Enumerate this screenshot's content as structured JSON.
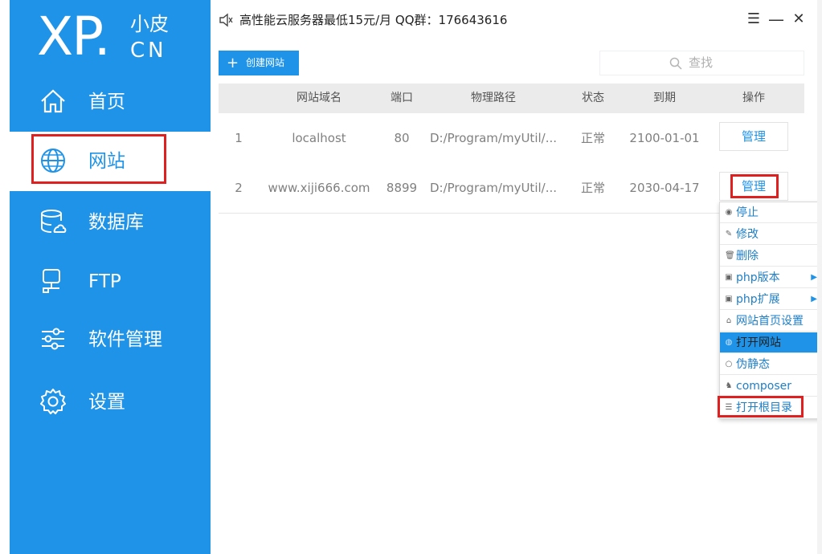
{
  "logo": {
    "main": "XP.",
    "top": "小皮",
    "bottom": "CN"
  },
  "sidebar": {
    "items": [
      {
        "label": "首页",
        "icon": "home-icon"
      },
      {
        "label": "网站",
        "icon": "globe-icon"
      },
      {
        "label": "数据库",
        "icon": "database-icon"
      },
      {
        "label": "FTP",
        "icon": "ftp-server-icon"
      },
      {
        "label": "软件管理",
        "icon": "sliders-icon"
      },
      {
        "label": "设置",
        "icon": "gear-icon"
      }
    ],
    "active_index": 1
  },
  "titlebar": {
    "announcement": "高性能云服务器最低15元/月  QQ群：176643616",
    "menu_glyph": "☰",
    "minimize_glyph": "—",
    "close_glyph": "✕"
  },
  "toolbar": {
    "create_label": "创建网站",
    "create_glyph": "+",
    "search_placeholder": "查找"
  },
  "table": {
    "columns": [
      "网站域名",
      "端口",
      "物理路径",
      "状态",
      "到期",
      "操作"
    ],
    "rows": [
      {
        "index": "1",
        "domain": "localhost",
        "port": "80",
        "path": "D:/Program/myUtil/...",
        "status": "正常",
        "expiry": "2100-01-01",
        "action": "管理"
      },
      {
        "index": "2",
        "domain": "www.xiji666.com",
        "port": "8899",
        "path": "D:/Program/myUtil/...",
        "status": "正常",
        "expiry": "2030-04-17",
        "action": "管理"
      }
    ]
  },
  "context_menu": {
    "items": [
      {
        "label": "停止",
        "glyph": "◉",
        "icon": "stop-icon"
      },
      {
        "label": "修改",
        "glyph": "✎",
        "icon": "edit-icon"
      },
      {
        "label": "删除",
        "glyph": "🗑",
        "icon": "trash-icon"
      },
      {
        "label": "php版本",
        "glyph": "▣",
        "icon": "php-version-icon",
        "submenu": true
      },
      {
        "label": "php扩展",
        "glyph": "▣",
        "icon": "php-extension-icon",
        "submenu": true
      },
      {
        "label": "网站首页设置",
        "glyph": "⌂",
        "icon": "home-small-icon"
      },
      {
        "label": "打开网站",
        "glyph": "◍",
        "icon": "open-site-icon"
      },
      {
        "label": "伪静态",
        "glyph": "○",
        "icon": "rewrite-icon"
      },
      {
        "label": "composer",
        "glyph": "♞",
        "icon": "composer-icon"
      },
      {
        "label": "打开根目录",
        "glyph": "☰",
        "icon": "list-icon"
      }
    ],
    "hover_index": 6,
    "submenu_arrow": "▶"
  },
  "colors": {
    "primary": "#1e93e8",
    "highlight_box": "#e02020",
    "header_bg": "#ebebeb"
  }
}
